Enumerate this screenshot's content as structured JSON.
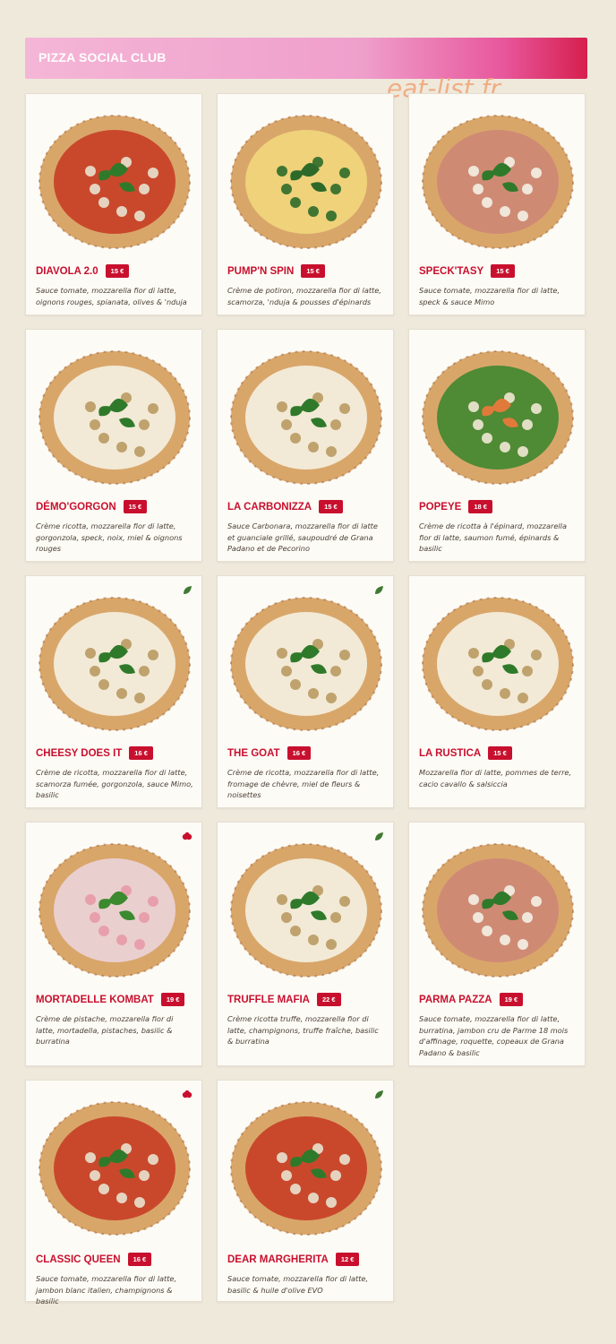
{
  "header": {
    "title": "PIZZA SOCIAL CLUB"
  },
  "watermark": "eat-list.fr",
  "colors": {
    "accent": "#c8102e",
    "background": "#efe9dc",
    "card": "#fdfbf6"
  },
  "menu": [
    {
      "name": "DIAVOLA 2.0",
      "price": "15 €",
      "description": "Sauce tomate, mozzarella fior di latte, oignons rouges, spianata, olives & 'nduja",
      "topping": "red",
      "tag": ""
    },
    {
      "name": "PUMP'N SPIN",
      "price": "15 €",
      "description": "Crème de potiron, mozzarella fior di latte, scamorza, 'nduja & pousses d'épinards",
      "topping": "yellow",
      "tag": ""
    },
    {
      "name": "SPECK'TASY",
      "price": "15 €",
      "description": "Sauce tomate, mozzarella fior di latte, speck & sauce Mimo",
      "topping": "ham",
      "tag": ""
    },
    {
      "name": "DÉMO'GORGON",
      "price": "15 €",
      "description": "Crème ricotta, mozzarella fior di latte, gorgonzola, speck, noix, miel & oignons rouges",
      "topping": "white",
      "tag": ""
    },
    {
      "name": "LA CARBONIZZA",
      "price": "15 €",
      "description": "Sauce Carbonara, mozzarella fior di latte et guanciale grillé, saupoudré de Grana Padano et de Pecorino",
      "topping": "white",
      "tag": ""
    },
    {
      "name": "POPEYE",
      "price": "18 €",
      "description": "Crème de ricotta à l'épinard, mozzarella fior di latte, saumon fumé, épinards & basilic",
      "topping": "green",
      "tag": ""
    },
    {
      "name": "CHEESY DOES IT",
      "price": "16 €",
      "description": "Crème de ricotta, mozzarella fior di latte, scamorza fumée, gorgonzola, sauce Mimo, basilic",
      "topping": "white",
      "tag": "leaf-icon"
    },
    {
      "name": "THE GOAT",
      "price": "16 €",
      "description": "Crème de ricotta, mozzarella fior di latte, fromage de chèvre, miel de fleurs & noisettes",
      "topping": "white",
      "tag": "leaf-icon"
    },
    {
      "name": "LA RUSTICA",
      "price": "15 €",
      "description": "Mozzarella fior di latte, pommes de terre, cacio cavallo & salsiccia",
      "topping": "white",
      "tag": ""
    },
    {
      "name": "MORTADELLE KOMBAT",
      "price": "19 €",
      "description": "Crème de pistache, mozzarella fior di latte, mortadella, pistaches, basilic & burratina",
      "topping": "pink",
      "tag": "pepper-icon"
    },
    {
      "name": "TRUFFLE MAFIA",
      "price": "22 €",
      "description": "Crème ricotta truffe, mozzarella fior di latte, champignons, truffe fraîche, basilic & burratina",
      "topping": "white",
      "tag": "leaf-icon"
    },
    {
      "name": "PARMA PAZZA",
      "price": "19 €",
      "description": "Sauce tomate, mozzarella fior di latte, burratina, jambon cru de Parme 18 mois d'affinage, roquette, copeaux de Grana Padano & basilic",
      "topping": "ham",
      "tag": ""
    },
    {
      "name": "CLASSIC QUEEN",
      "price": "16 €",
      "description": "Sauce tomate, mozzarella fior di latte, jambon blanc italien, champignons & basilic",
      "topping": "red",
      "tag": "pepper-icon"
    },
    {
      "name": "DEAR MARGHERITA",
      "price": "12 €",
      "description": "Sauce tomate, mozzarella fior di latte, basilic & huile d'olive EVO",
      "topping": "red",
      "tag": "leaf-icon"
    }
  ]
}
